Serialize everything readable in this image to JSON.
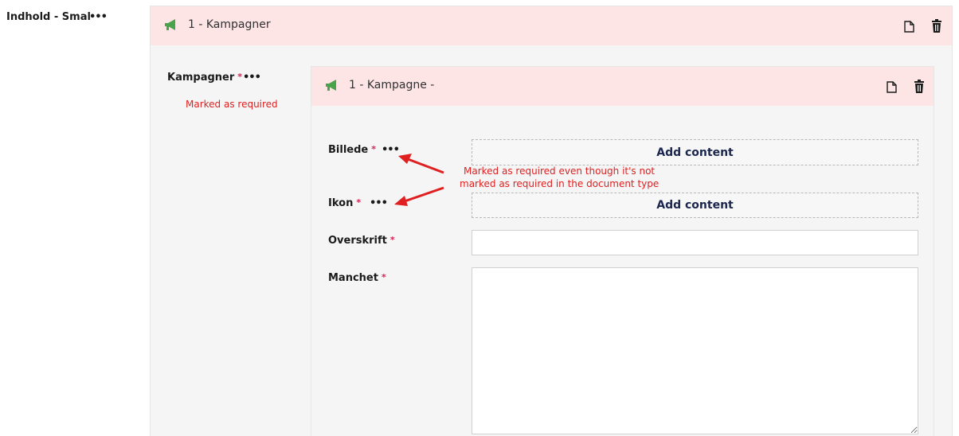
{
  "left_label": "Indhold - Smal",
  "outer_block": {
    "title": "1 - Kampagner"
  },
  "kampagner": {
    "label": "Kampagner",
    "required_mark": "*",
    "note": "Marked as required"
  },
  "inner_block": {
    "title": "1 - Kampagne -"
  },
  "fields": {
    "billede": {
      "label": "Billede",
      "required_mark": "*",
      "button": "Add content"
    },
    "ikon": {
      "label": "Ikon",
      "required_mark": "*",
      "button": "Add content"
    },
    "overskrift": {
      "label": "Overskrift",
      "required_mark": "*",
      "value": ""
    },
    "manchet": {
      "label": "Manchet",
      "required_mark": "*",
      "value": ""
    }
  },
  "annotation": {
    "line1": "Marked as required even though it's not",
    "line2": "marked as required in the document type"
  },
  "dots": "•••",
  "colors": {
    "header_bg": "#fde5e5",
    "icon_green": "#4aa34a",
    "required": "#d42054",
    "annotation_red": "#e02020"
  }
}
